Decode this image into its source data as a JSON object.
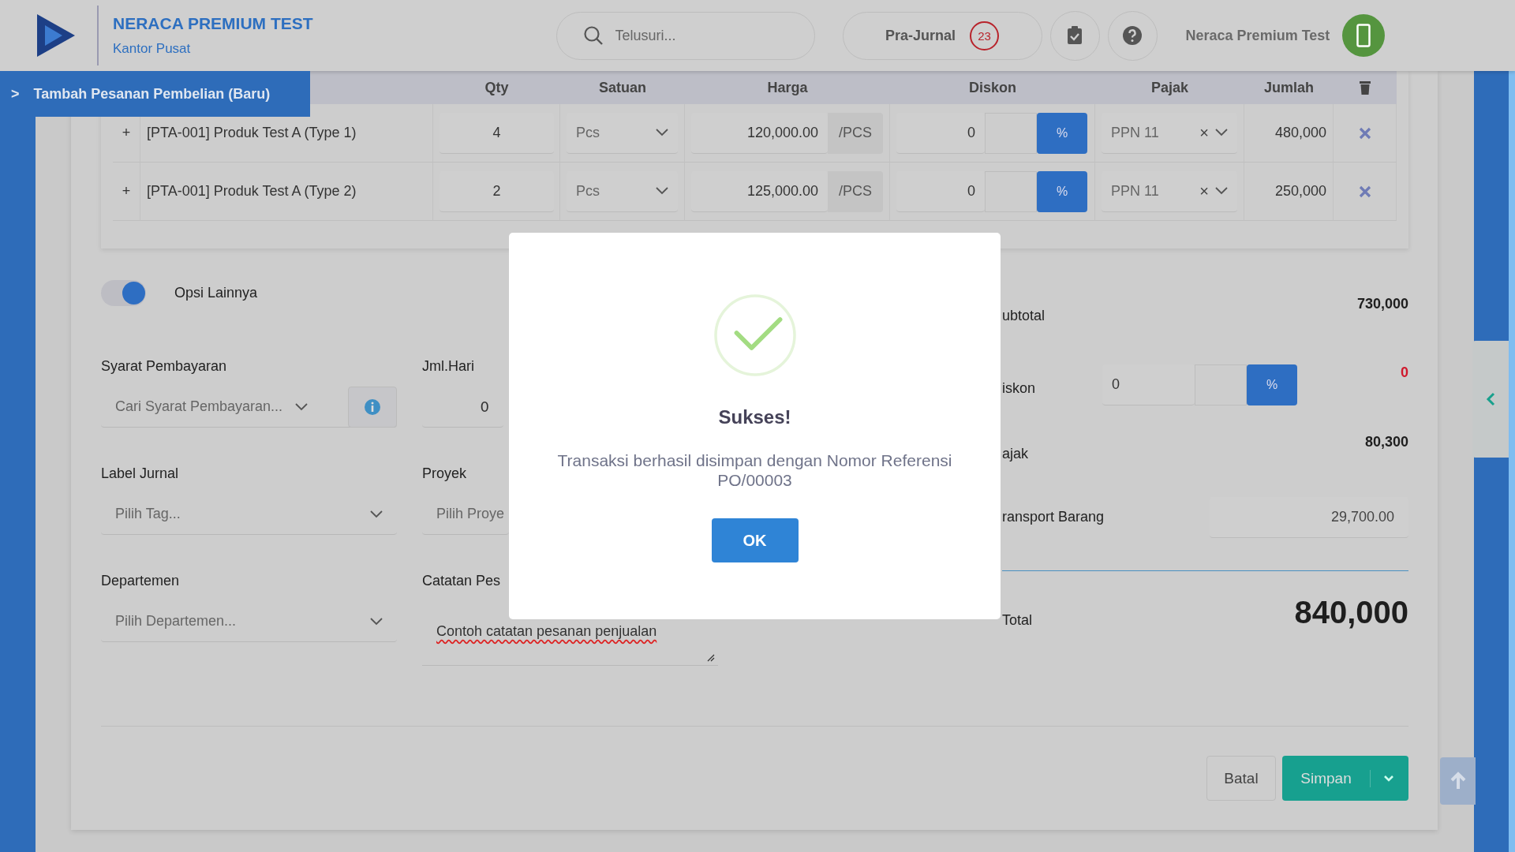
{
  "header": {
    "company": "NERACA PREMIUM TEST",
    "branch": "Kantor Pusat",
    "search": {
      "placeholder": "Telusuri..."
    },
    "pra_jurnal": {
      "label": "Pra-Jurnal",
      "count": "23"
    },
    "user": "Neraca Premium Test"
  },
  "page_tab": {
    "arrow": ">",
    "title": "Tambah Pesanan Pembelian (Baru)"
  },
  "table": {
    "columns": [
      "Qty",
      "Satuan",
      "Harga",
      "Diskon",
      "Pajak",
      "Jumlah"
    ],
    "rows": [
      {
        "expand": "+",
        "product": "[PTA-001] Produk Test A (Type 1)",
        "qty": "4",
        "unit": "Pcs",
        "price": "120,000.00",
        "price_unit": "/PCS",
        "discount": "0",
        "discount_mode": "%",
        "tax": "PPN 11",
        "tax_clear": "×",
        "amount": "480,000"
      },
      {
        "expand": "+",
        "product": "[PTA-001] Produk Test A (Type 2)",
        "qty": "2",
        "unit": "Pcs",
        "price": "125,000.00",
        "price_unit": "/PCS",
        "discount": "0",
        "discount_mode": "%",
        "tax": "PPN 11",
        "tax_clear": "×",
        "amount": "250,000"
      }
    ]
  },
  "options": {
    "label": "Opsi Lainnya",
    "on": true
  },
  "form": {
    "payment_terms": {
      "label": "Syarat Pembayaran",
      "placeholder": "Cari Syarat Pembayaran..."
    },
    "days": {
      "label": "Jml.Hari",
      "value": "0"
    },
    "journal_label": {
      "label": "Label Jurnal",
      "placeholder": "Pilih Tag..."
    },
    "project": {
      "label": "Proyek",
      "placeholder": "Pilih Proye"
    },
    "department": {
      "label": "Departemen",
      "placeholder": "Pilih Departemen..."
    },
    "notes": {
      "label": "Catatan Pes",
      "value": "Contoh catatan pesanan penjualan"
    }
  },
  "totals": {
    "subtotal": {
      "label": "ubtotal",
      "value": "730,000"
    },
    "discount": {
      "label": "iskon",
      "input": "0",
      "mode": "%",
      "value": "0"
    },
    "tax": {
      "label": "ajak",
      "value": "80,300"
    },
    "transport": {
      "label": "ransport Barang",
      "value": "29,700.00"
    },
    "total": {
      "label": "Total",
      "value": "840,000"
    }
  },
  "footer": {
    "cancel": "Batal",
    "save": "Simpan"
  },
  "dialog": {
    "title": "Sukses!",
    "message": "Transaksi berhasil disimpan dengan Nomor Referensi PO/00003",
    "button": "OK"
  }
}
